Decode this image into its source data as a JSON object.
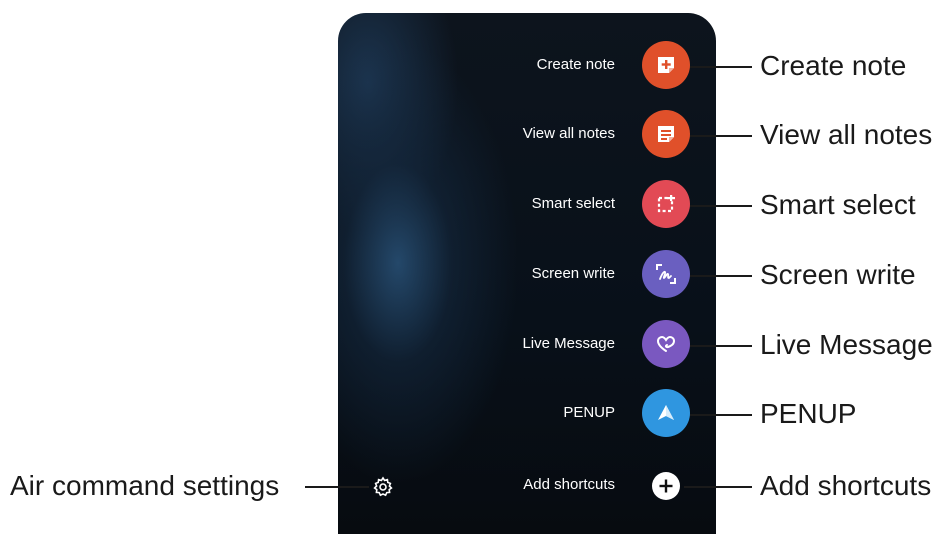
{
  "menu": {
    "items": [
      {
        "id": "create-note",
        "label": "Create note",
        "icon": "note-add-icon",
        "color": "#e0502a"
      },
      {
        "id": "view-all-notes",
        "label": "View all notes",
        "icon": "notes-list-icon",
        "color": "#e0502a"
      },
      {
        "id": "smart-select",
        "label": "Smart select",
        "icon": "crop-select-icon",
        "color": "#e24a55"
      },
      {
        "id": "screen-write",
        "label": "Screen write",
        "icon": "screen-write-icon",
        "color": "#6a5fc0"
      },
      {
        "id": "live-message",
        "label": "Live Message",
        "icon": "heart-scribble-icon",
        "color": "#7a58c0"
      },
      {
        "id": "penup",
        "label": "PENUP",
        "icon": "penup-icon",
        "color": "#2f96e0"
      },
      {
        "id": "add-shortcuts",
        "label": "Add shortcuts",
        "icon": "plus-icon",
        "color": "#ffffff"
      }
    ],
    "settings_icon": "gear-icon"
  },
  "callouts": {
    "create_note": "Create note",
    "view_all_notes": "View all notes",
    "smart_select": "Smart select",
    "screen_write": "Screen write",
    "live_message": "Live Message",
    "penup": "PENUP",
    "add_shortcuts": "Add shortcuts",
    "air_command_settings": "Air command settings"
  }
}
